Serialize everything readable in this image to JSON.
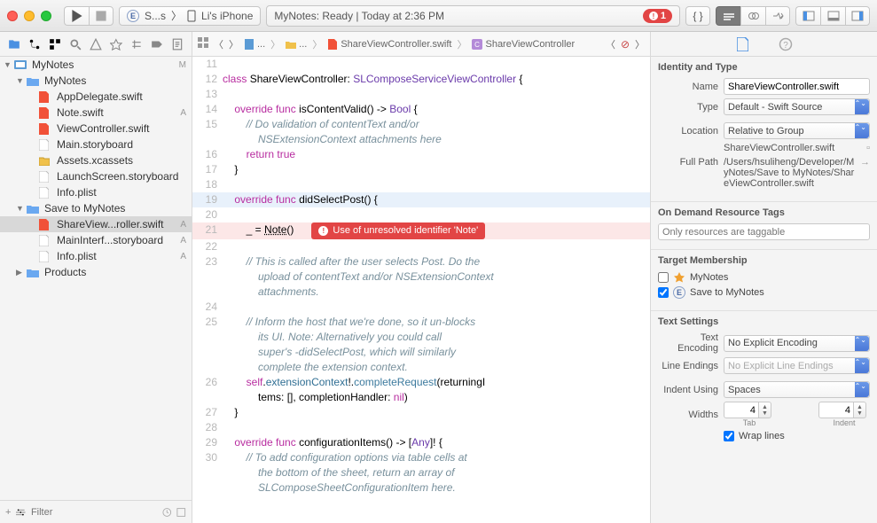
{
  "titlebar": {
    "scheme_app": "S...s",
    "scheme_device": "Li's iPhone",
    "status_app": "MyNotes: ",
    "status_ready": "Ready",
    "status_time": "Today at 2:36 PM",
    "error_count": "1"
  },
  "navigator": {
    "root": "MyNotes",
    "root_badge": "M",
    "g1": "MyNotes",
    "f_appdel": "AppDelegate.swift",
    "f_note": "Note.swift",
    "f_note_badge": "A",
    "f_vc": "ViewController.swift",
    "f_main": "Main.storyboard",
    "f_assets": "Assets.xcassets",
    "f_launch": "LaunchScreen.storyboard",
    "f_info1": "Info.plist",
    "g2": "Save to MyNotes",
    "f_svc": "ShareView...roller.swift",
    "f_svc_badge": "A",
    "f_mainif": "MainInterf...storyboard",
    "f_mainif_badge": "A",
    "f_info2": "Info.plist",
    "f_info2_badge": "A",
    "g3": "Products",
    "filter_placeholder": "Filter"
  },
  "jumpbar": {
    "c1": "...",
    "c2": "...",
    "c3": "ShareViewController.swift",
    "c4": "ShareViewController"
  },
  "code": {
    "l11": "",
    "l12_cls": "class",
    "l12_name": "ShareViewController",
    "l12_super": "SLComposeServiceViewController",
    "l13": "",
    "l14_ov": "override",
    "l14_fn": "func",
    "l14_name": "isContentValid",
    "l14_bool": "Bool",
    "l15": "// Do validation of contentText and/or\n            NSExtensionContext attachments here",
    "l16_ret": "return",
    "l16_val": "true",
    "l17": "    }",
    "l18": "",
    "l19_ov": "override",
    "l19_fn": "func",
    "l19_name": "didSelectPost",
    "l20": "",
    "l21_lhs": "_ =",
    "l21_note": "Note",
    "l21_err": "Use of unresolved identifier 'Note'",
    "l22": "",
    "l23": "// This is called after the user selects Post. Do the\n            upload of contentText and/or NSExtensionContext\n            attachments.",
    "l24": "",
    "l25": "// Inform the host that we're done, so it un-blocks\n            its UI. Note: Alternatively you could call\n            super's -didSelectPost, which will similarly\n            complete the extension context.",
    "l26_self": "self",
    "l26_ec": "extensionContext",
    "l26_cr": "completeRequest",
    "l26_ri": "returningI",
    "l26b_tems": "tems: [],",
    "l26b_ch": "completionHandler:",
    "l26b_nil": "nil",
    "l27": "    }",
    "l28": "",
    "l29_ov": "override",
    "l29_fn": "func",
    "l29_name": "configurationItems",
    "l29_any": "Any",
    "l30": "// To add configuration options via table cells at\n            the bottom of the sheet, return an array of\n            SLComposeSheetConfigurationItem here."
  },
  "inspector": {
    "s1_hdr": "Identity and Type",
    "name_lbl": "Name",
    "name_val": "ShareViewController.swift",
    "type_lbl": "Type",
    "type_val": "Default - Swift Source",
    "loc_lbl": "Location",
    "loc_val": "Relative to Group",
    "loc_path": "ShareViewController.swift",
    "fp_lbl": "Full Path",
    "fp_val": "/Users/hsuliheng/Developer/MyNotes/Save to MyNotes/ShareViewController.swift",
    "s2_hdr": "On Demand Resource Tags",
    "s2_ph": "Only resources are taggable",
    "s3_hdr": "Target Membership",
    "t1": "MyNotes",
    "t2": "Save to MyNotes",
    "s4_hdr": "Text Settings",
    "te_lbl": "Text Encoding",
    "te_val": "No Explicit Encoding",
    "le_lbl": "Line Endings",
    "le_val": "No Explicit Line Endings",
    "iu_lbl": "Indent Using",
    "iu_val": "Spaces",
    "w_lbl": "Widths",
    "tab_val": "4",
    "tab_lbl": "Tab",
    "ind_val": "4",
    "ind_lbl": "Indent",
    "wrap_lbl": "Wrap lines"
  }
}
